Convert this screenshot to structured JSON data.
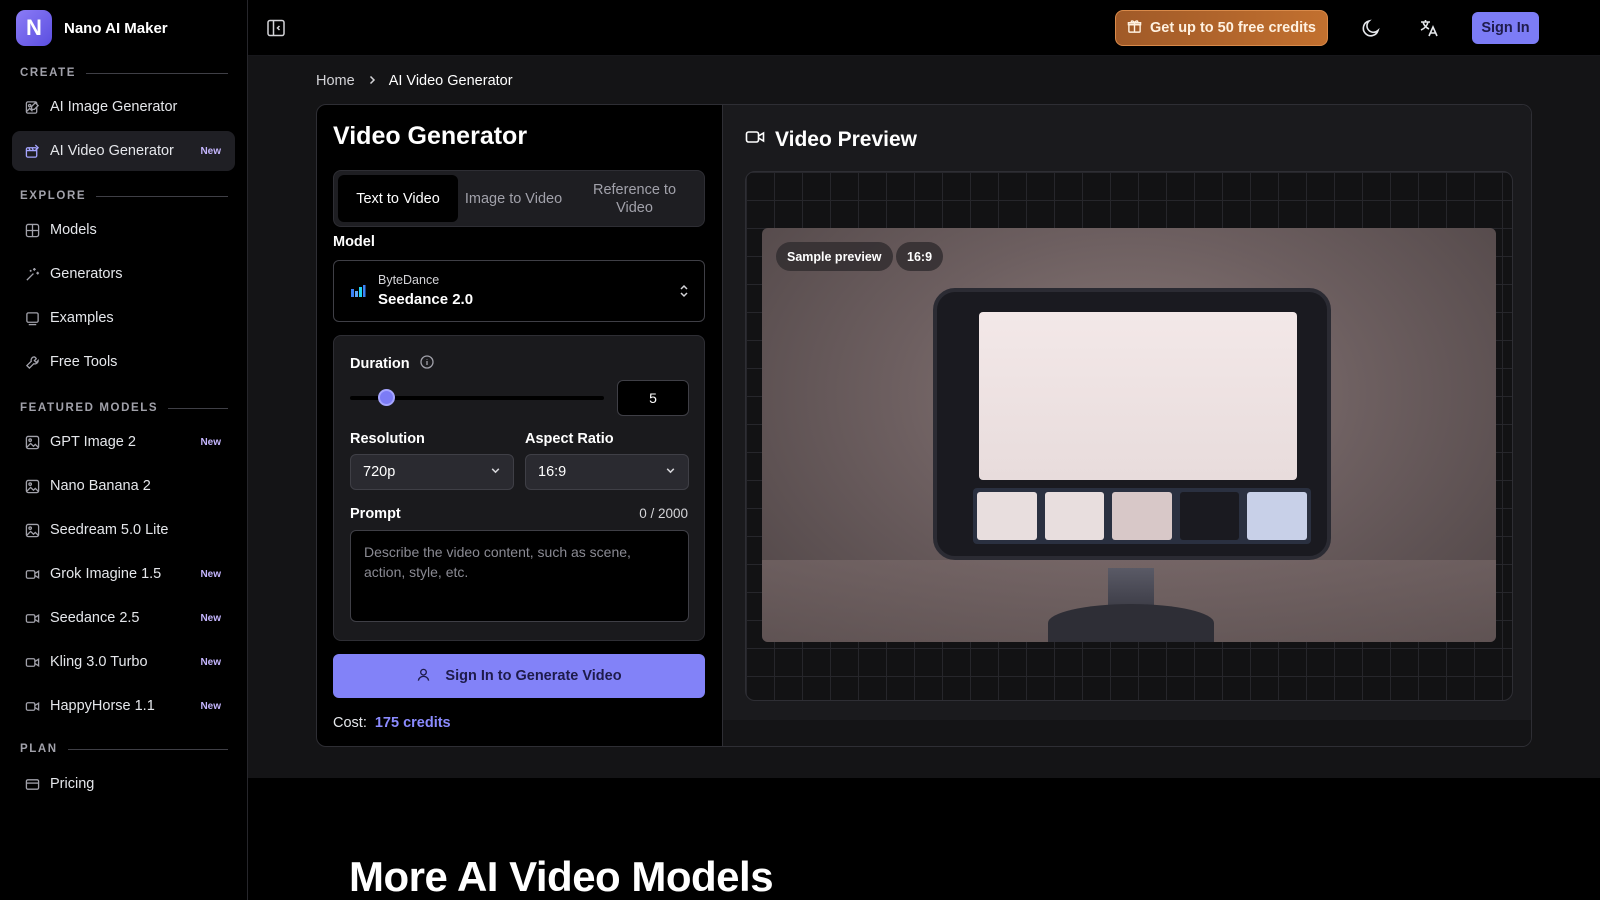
{
  "app": {
    "brand_letter": "N",
    "name": "Nano AI Maker"
  },
  "sidebar": {
    "sections": {
      "create": "CREATE",
      "explore": "EXPLORE",
      "featured": "FEATURED MODELS",
      "plan": "PLAN"
    },
    "items": [
      {
        "label": "AI Image Generator",
        "icon": "image-edit-icon"
      },
      {
        "label": "AI Video Generator",
        "icon": "video-edit-icon",
        "badge": "New",
        "active": true
      },
      {
        "label": "Models",
        "icon": "grid-icon"
      },
      {
        "label": "Generators",
        "icon": "sparkles-icon"
      },
      {
        "label": "Examples",
        "icon": "gallery-icon"
      },
      {
        "label": "Free Tools",
        "icon": "wrench-icon"
      },
      {
        "label": "GPT Image 2",
        "icon": "image-icon",
        "badge": "New"
      },
      {
        "label": "Nano Banana 2",
        "icon": "image-icon"
      },
      {
        "label": "Seedream 5.0 Lite",
        "icon": "image-icon"
      },
      {
        "label": "Grok Imagine 1.5",
        "icon": "video-icon",
        "badge": "New"
      },
      {
        "label": "Seedance 2.5",
        "icon": "video-icon",
        "badge": "New"
      },
      {
        "label": "Kling 3.0 Turbo",
        "icon": "video-icon",
        "badge": "New"
      },
      {
        "label": "HappyHorse 1.1",
        "icon": "video-icon",
        "badge": "New"
      },
      {
        "label": "Pricing",
        "icon": "credit-card-icon"
      }
    ]
  },
  "header": {
    "credits_cta": "Get up to 50 free credits",
    "sign_in": "Sign In"
  },
  "breadcrumb": {
    "home": "Home",
    "current": "AI Video Generator"
  },
  "generator": {
    "title": "Video Generator",
    "tabs": [
      "Text to Video",
      "Image to Video",
      "Reference to Video"
    ],
    "active_tab": 0,
    "model_label": "Model",
    "model_brand": "ByteDance",
    "model_name": "Seedance 2.0",
    "duration_label": "Duration",
    "duration_value": "5",
    "duration_fraction": 0.12,
    "resolution_label": "Resolution",
    "resolution_value": "720p",
    "aspect_label": "Aspect Ratio",
    "aspect_value": "16:9",
    "prompt_label": "Prompt",
    "prompt_counter": "0 / 2000",
    "prompt_placeholder": "Describe the video content, such as scene, action, style, etc.",
    "generate_button": "Sign In to Generate Video",
    "cost_label": "Cost:",
    "cost_value": "175 credits"
  },
  "preview": {
    "title": "Video Preview",
    "tag_sample": "Sample preview",
    "tag_ratio": "16:9"
  },
  "section": {
    "heading": "More AI Video Models"
  },
  "colors": {
    "accent": "#7c7cf6",
    "credits": "#c2702f",
    "background": "#000000"
  }
}
